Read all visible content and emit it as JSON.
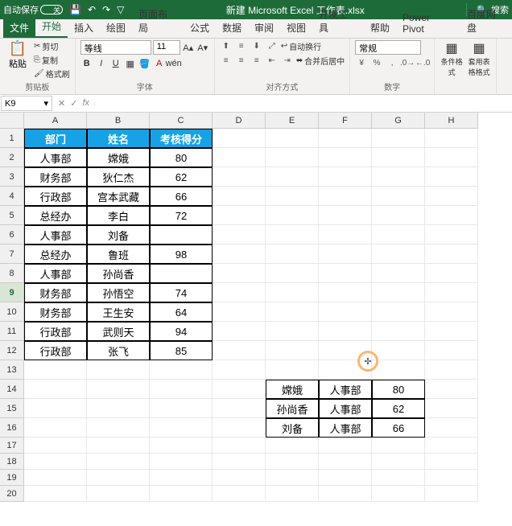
{
  "titlebar": {
    "autosave_label": "自动保存",
    "autosave_state": "关",
    "doc_title": "新建 Microsoft Excel 工作表.xlsx",
    "search_label": "搜索"
  },
  "qat": {
    "save": "💾",
    "undo": "↶",
    "redo": "↷",
    "filter": "▽"
  },
  "tabs": {
    "file": "文件",
    "home": "开始",
    "insert": "插入",
    "draw": "绘图",
    "layout": "页面布局",
    "formula": "公式",
    "data": "数据",
    "review": "审阅",
    "view": "视图",
    "dev": "开发工具",
    "help": "帮助",
    "powerpivot": "Power Pivot",
    "baidu": "百度网盘"
  },
  "ribbon": {
    "clipboard": {
      "paste": "粘贴",
      "cut": "剪切",
      "copy": "复制",
      "format_painter": "格式刷",
      "group_label": "剪贴板"
    },
    "font": {
      "name": "等线",
      "size": "11",
      "group_label": "字体"
    },
    "align": {
      "wrap": "自动换行",
      "merge": "合并后居中",
      "group_label": "对齐方式"
    },
    "number": {
      "format": "常规",
      "group_label": "数字"
    },
    "styles": {
      "cond": "条件格式",
      "table": "套用表格格式"
    }
  },
  "formula": {
    "cell_ref": "K9",
    "fx_value": ""
  },
  "col_headers": [
    "A",
    "B",
    "C",
    "D",
    "E",
    "F",
    "G",
    "H"
  ],
  "row_headers": [
    "1",
    "2",
    "3",
    "4",
    "5",
    "6",
    "7",
    "8",
    "9",
    "10",
    "11",
    "12",
    "13",
    "14",
    "15",
    "16",
    "17",
    "18",
    "19",
    "20"
  ],
  "table1": {
    "headers": [
      "部门",
      "姓名",
      "考核得分"
    ],
    "rows": [
      [
        "人事部",
        "嫦娥",
        "80"
      ],
      [
        "财务部",
        "狄仁杰",
        "62"
      ],
      [
        "行政部",
        "宫本武藏",
        "66"
      ],
      [
        "总经办",
        "李白",
        "72"
      ],
      [
        "人事部",
        "刘备",
        ""
      ],
      [
        "总经办",
        "鲁班",
        "98"
      ],
      [
        "人事部",
        "孙尚香",
        ""
      ],
      [
        "财务部",
        "孙悟空",
        "74"
      ],
      [
        "财务部",
        "王生安",
        "64"
      ],
      [
        "行政部",
        "武则天",
        "94"
      ],
      [
        "行政部",
        "张飞",
        "85"
      ]
    ]
  },
  "table2": {
    "rows": [
      [
        "嫦娥",
        "人事部",
        "80"
      ],
      [
        "孙尚香",
        "人事部",
        "62"
      ],
      [
        "刘备",
        "人事部",
        "66"
      ]
    ]
  },
  "selected_cell": "K9"
}
